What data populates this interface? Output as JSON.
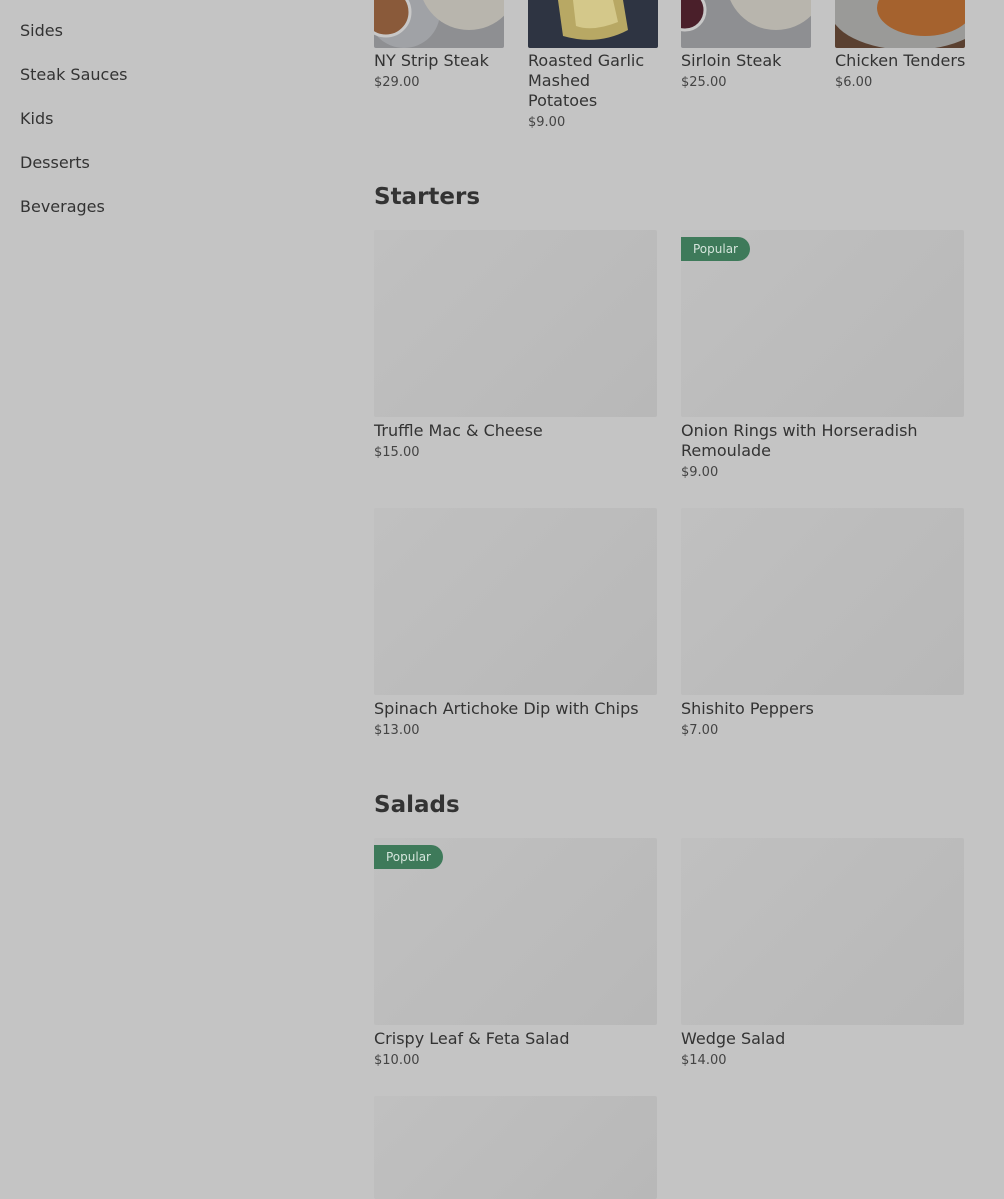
{
  "sidebar": {
    "items": [
      {
        "label": "Sides"
      },
      {
        "label": "Steak Sauces"
      },
      {
        "label": "Kids"
      },
      {
        "label": "Desserts"
      },
      {
        "label": "Beverages"
      }
    ]
  },
  "top_row": [
    {
      "name": "NY Strip Steak",
      "price": "$29.00"
    },
    {
      "name": "Roasted Garlic Mashed Potatoes",
      "price": "$9.00"
    },
    {
      "name": "Sirloin Steak",
      "price": "$25.00"
    },
    {
      "name": "Chicken Tenders",
      "price": "$6.00"
    }
  ],
  "starters": {
    "title": "Starters",
    "items": [
      {
        "name": "Truffle Mac & Cheese",
        "price": "$15.00"
      },
      {
        "name": "Onion Rings with Horseradish Remoulade",
        "price": "$9.00",
        "badge": "Popular"
      },
      {
        "name": "Spinach Artichoke Dip with Chips",
        "price": "$13.00"
      },
      {
        "name": "Shishito Peppers",
        "price": "$7.00"
      }
    ]
  },
  "salads": {
    "title": "Salads",
    "items": [
      {
        "name": "Crispy Leaf & Feta Salad",
        "price": "$10.00",
        "badge": "Popular"
      },
      {
        "name": "Wedge Salad",
        "price": "$14.00"
      }
    ]
  },
  "colors": {
    "overlay": "#c4c4c4",
    "badge_bg": "#3e7a5a"
  }
}
